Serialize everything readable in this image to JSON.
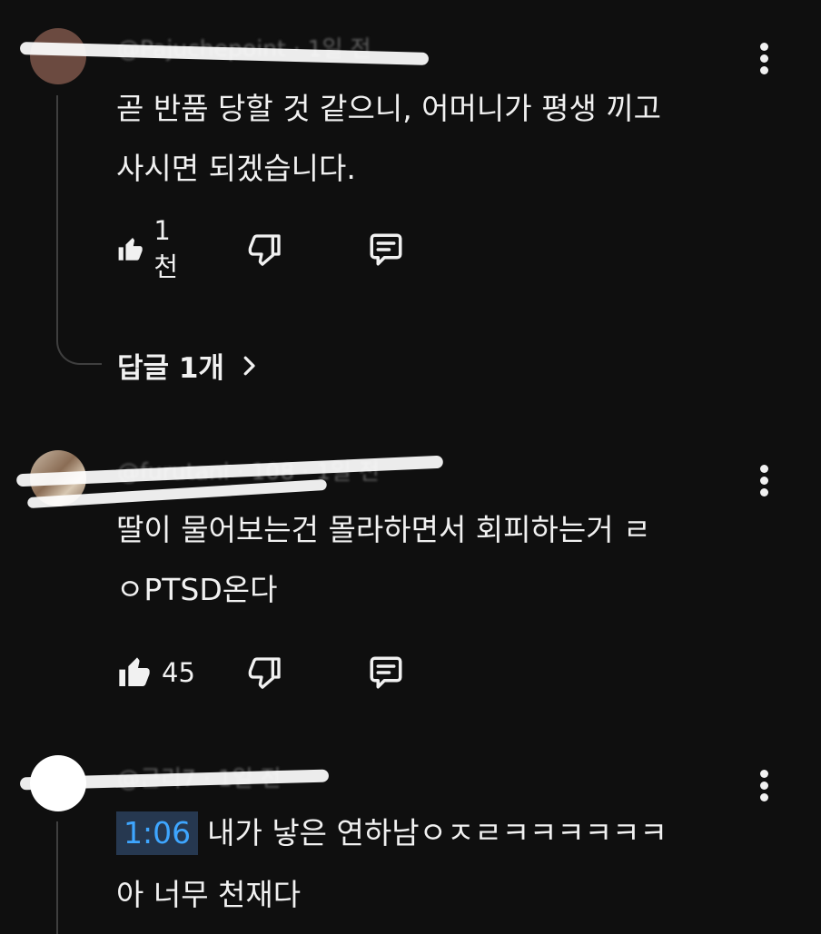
{
  "comments": [
    {
      "meta": "@Pajuchepoint · 1일 전",
      "text_lines": [
        "곧 반품 당할 것 같으니, 어머니가 평생 끼고",
        "사시면 되겠습니다."
      ],
      "likes": "1천",
      "replies_label": "답글 1개"
    },
    {
      "meta": "@furutani · 108 · 1일 전",
      "text_lines": [
        "딸이 물어보는건 몰라하면서 회피하는거 ㄹ",
        "ㅇPTSD온다"
      ],
      "likes": "45"
    },
    {
      "meta": "@근리7 · 1일 전",
      "timestamp": "1:06",
      "text_lines": [
        "내가 낳은 연하남ㅇㅈㄹㅋㅋㅋㅋㅋㅋ",
        "아 너무 천재다"
      ]
    }
  ],
  "icons": [
    "like-icon",
    "dislike-icon",
    "reply-icon",
    "more-vert-icon",
    "chevron-right-icon"
  ],
  "colors": {
    "background": "#0f0f0f",
    "text": "#f1f1f1",
    "timestamp_link": "#3ea6ff",
    "timestamp_bg": "#263850"
  }
}
